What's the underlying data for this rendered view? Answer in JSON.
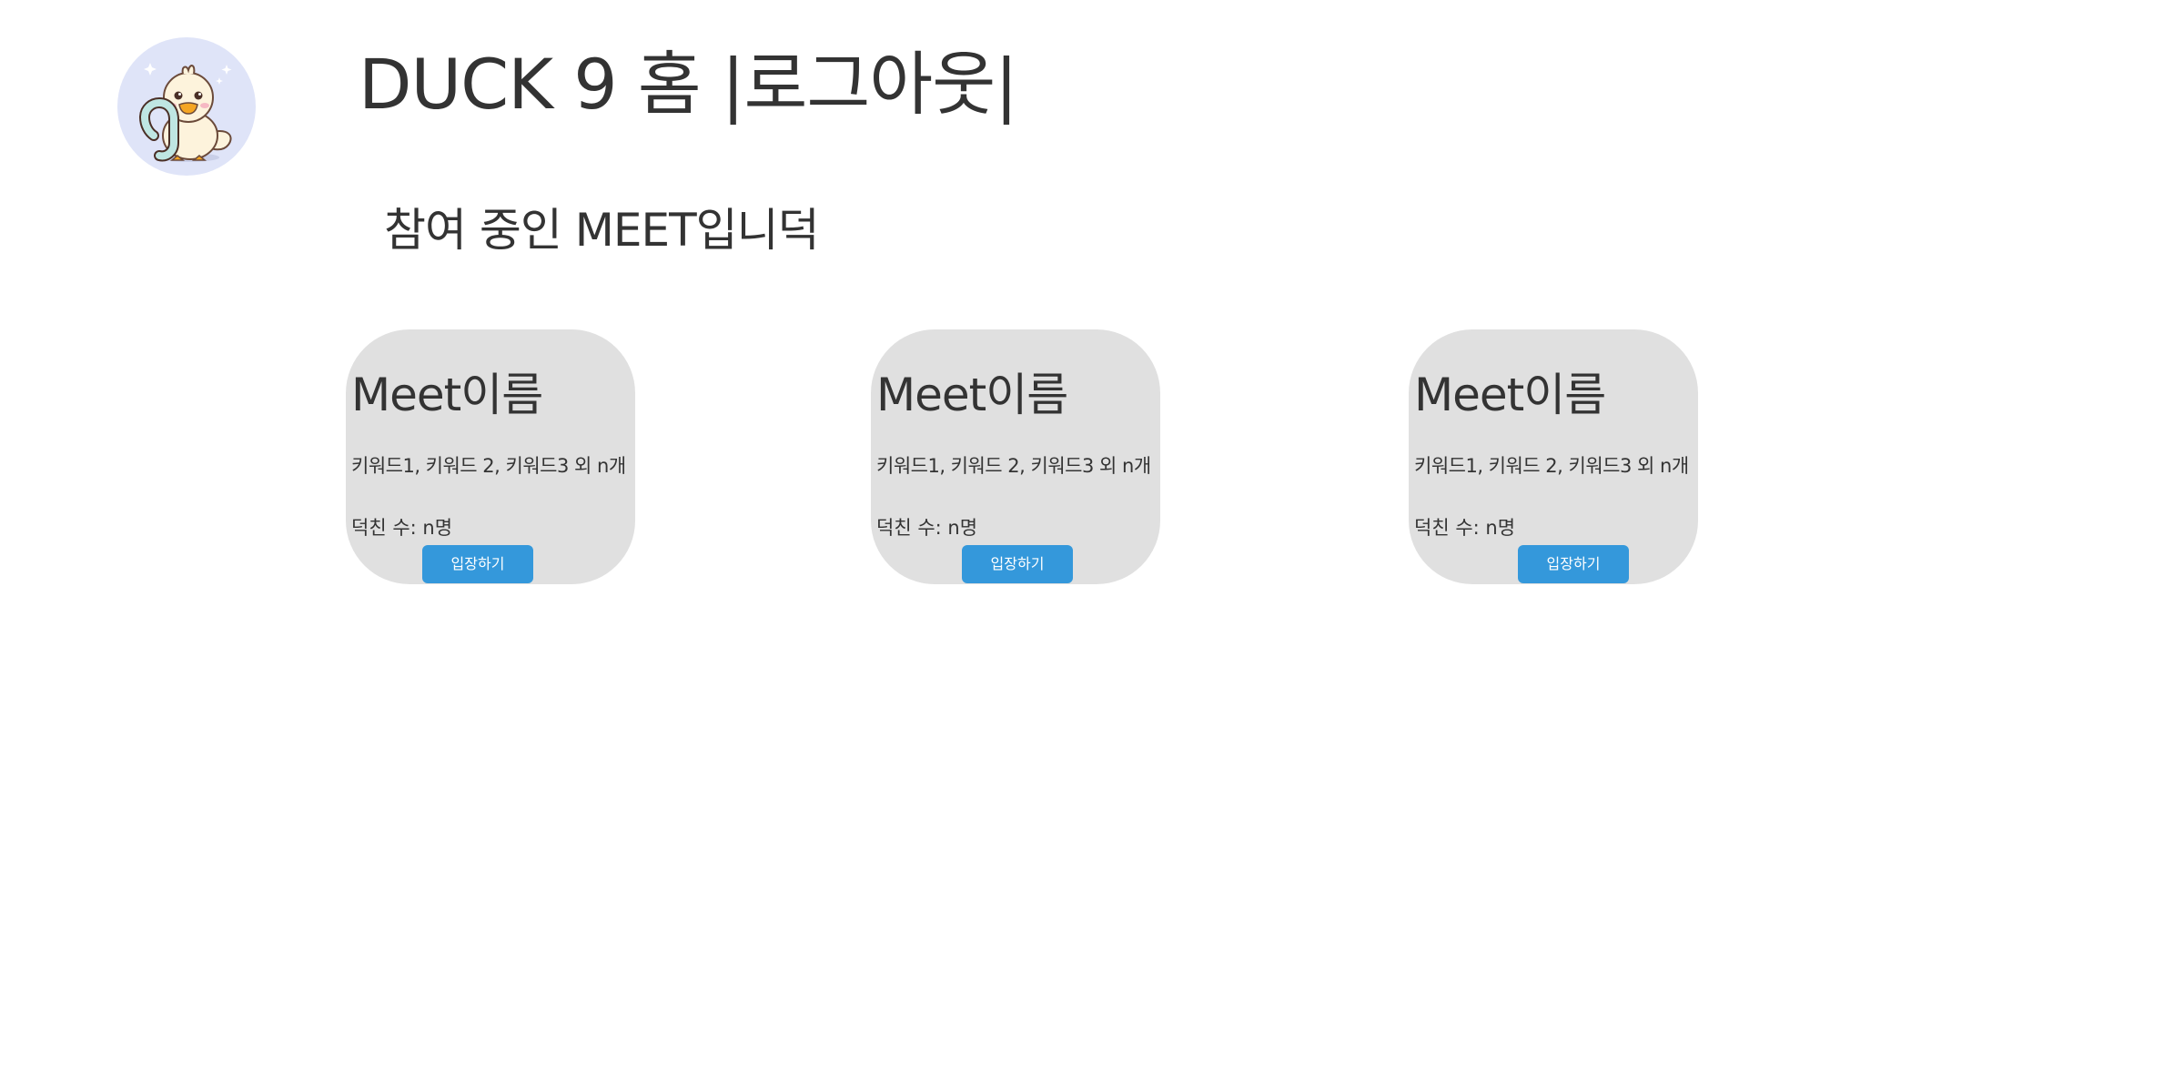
{
  "header": {
    "logo_alt": "DUCK 9 logo",
    "title": "DUCK 9 홈",
    "separator_left": "|",
    "logout_label": "로그아웃",
    "separator_right": "|"
  },
  "subtitle": "참여 중인 MEET입니덕",
  "meets": [
    {
      "name": "Meet이름",
      "keywords": "키워드1, 키워드 2, 키워드3 외 n개",
      "members": "덕친 수: n명",
      "enter_label": "입장하기"
    },
    {
      "name": "Meet이름",
      "keywords": "키워드1, 키워드 2, 키워드3 외 n개",
      "members": "덕친 수: n명",
      "enter_label": "입장하기"
    },
    {
      "name": "Meet이름",
      "keywords": "키워드1, 키워드 2, 키워드3 외 n개",
      "members": "덕친 수: n명",
      "enter_label": "입장하기"
    }
  ],
  "colors": {
    "text": "#333333",
    "card_background": "#e0e0e0",
    "button": "#3498db",
    "button_text": "#ffffff",
    "logo_background": "#dfe4f8"
  }
}
